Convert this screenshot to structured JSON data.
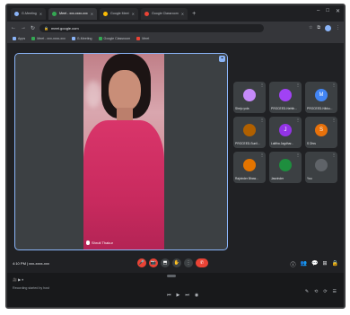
{
  "browser": {
    "tabs": [
      {
        "label": "G-Meeting",
        "color": "#8ab4f8",
        "active": false
      },
      {
        "label": "Meet - xxx-xxxx-xxx",
        "color": "#34a853",
        "active": true
      },
      {
        "label": "Google Meet",
        "color": "#fbbc04",
        "active": false
      },
      {
        "label": "Google Classroom",
        "color": "#ea4335",
        "active": false
      }
    ],
    "new_tab": "+",
    "window_controls": [
      "–",
      "□",
      "✕"
    ],
    "url": "meet.google.com",
    "nav": [
      "←",
      "→",
      "↻"
    ],
    "bookmarks": [
      {
        "label": "Apps",
        "color": "#8ab4f8"
      },
      {
        "label": "Meet - xxx-xxxx-xxx",
        "color": "#34a853"
      },
      {
        "label": "G-Meeting",
        "color": "#8ab4f8"
      },
      {
        "label": "Google Classroom",
        "color": "#34a853"
      },
      {
        "label": "Meet",
        "color": "#ea4335"
      }
    ]
  },
  "main_tile": {
    "name": "Shruti Thakur",
    "pin": "⌖"
  },
  "participants": [
    {
      "name": "Sheju yola",
      "avatar_text": "",
      "color": "#c58af9",
      "more": "⋮"
    },
    {
      "name": "PROCEED-Nehth...",
      "avatar_text": "",
      "color": "#a142f4",
      "more": "⋮"
    },
    {
      "name": "PROCEED-Nikku...",
      "avatar_text": "M",
      "color": "#4285f4",
      "more": "⋮"
    },
    {
      "name": "PROCEED-Sunil...",
      "avatar_text": "",
      "color": "#b06000",
      "more": "⋮"
    },
    {
      "name": "Lalitha Jagdhar...",
      "avatar_text": "J",
      "color": "#9334e6",
      "more": "⋮"
    },
    {
      "name": "S Dhru",
      "avatar_text": "S",
      "color": "#e8710a",
      "more": "⋮"
    },
    {
      "name": "Rajvinder Bhaw...",
      "avatar_text": "",
      "color": "#e37400",
      "more": "⋮"
    },
    {
      "name": "Jasvinder",
      "avatar_text": "",
      "color": "#1e8e3e",
      "more": "⋮"
    },
    {
      "name": "You",
      "avatar_text": "",
      "color": "#5f6368",
      "more": "⋮"
    }
  ],
  "meetbar": {
    "info": "4:10 PM  |  xxx-xxxx-xxx",
    "controls": [
      "🎤",
      "📷",
      "⬒",
      "✋",
      "⋮"
    ],
    "end": "✆",
    "right_icons": [
      "ⓘ",
      "👥",
      "💬",
      "⊞",
      "🔒"
    ]
  },
  "bottom": {
    "line1": "🎥  ▶  ⏸",
    "line2": "Recording started by host",
    "mid_icons": [
      "⏮",
      "▶",
      "⏭",
      "◉"
    ],
    "right_icons": [
      "✎",
      "⟲",
      "⟳",
      "☰"
    ]
  }
}
